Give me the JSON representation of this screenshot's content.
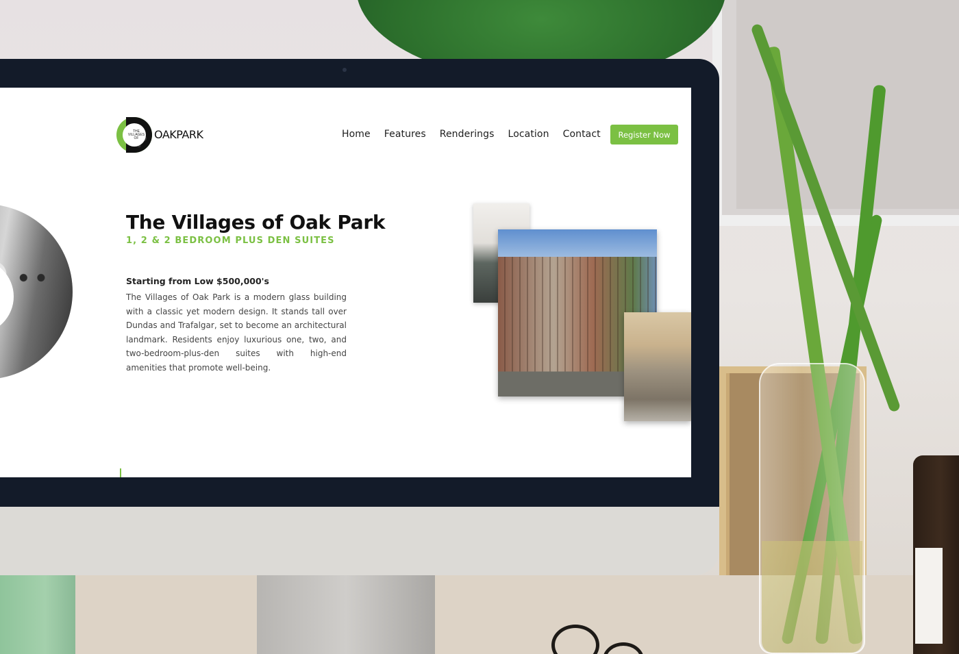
{
  "site": {
    "logo": {
      "small_text": "THE VILLAGES OF",
      "wordmark": "OAKPARK"
    },
    "nav": {
      "items": [
        {
          "label": "Home"
        },
        {
          "label": "Features"
        },
        {
          "label": "Renderings"
        },
        {
          "label": "Location"
        },
        {
          "label": "Contact"
        }
      ],
      "cta_label": "Register Now"
    },
    "hero": {
      "title": "The Villages of Oak Park",
      "subtitle": "1, 2 & 2 BEDROOM PLUS DEN SUITES",
      "price_heading": "Starting from Low $500,000's",
      "description": "The Villages of Oak Park is a modern glass building with a classic yet modern design. It stands tall over Dundas and Trafalgar, set to become an architectural landmark. Residents enjoy luxurious one, two, and two-bedroom-plus-den suites with high-end amenities that promote well-being."
    }
  },
  "colors": {
    "accent": "#7bc043",
    "bezel": "#131b29",
    "text": "#111111"
  }
}
